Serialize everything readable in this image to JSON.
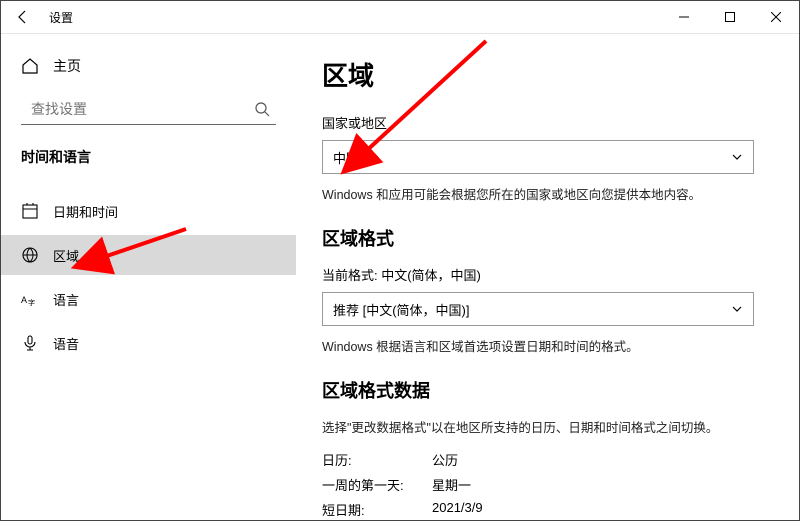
{
  "titlebar": {
    "title": "设置"
  },
  "sidebar": {
    "home": "主页",
    "search_placeholder": "查找设置",
    "category": "时间和语言",
    "items": [
      {
        "label": "日期和时间"
      },
      {
        "label": "区域"
      },
      {
        "label": "语言"
      },
      {
        "label": "语音"
      }
    ]
  },
  "main": {
    "heading": "区域",
    "country_label": "国家或地区",
    "country_value": "中国",
    "country_desc": "Windows 和应用可能会根据您所在的国家或地区向您提供本地内容。",
    "format_heading": "区域格式",
    "current_format_label": "当前格式: 中文(简体，中国)",
    "format_value": "推荐 [中文(简体，中国)]",
    "format_desc": "Windows 根据语言和区域首选项设置日期和时间的格式。",
    "data_heading": "区域格式数据",
    "data_desc": "选择\"更改数据格式\"以在地区所支持的日历、日期和时间格式之间切换。",
    "rows": [
      {
        "k": "日历:",
        "v": "公历"
      },
      {
        "k": "一周的第一天:",
        "v": "星期一"
      },
      {
        "k": "短日期:",
        "v": "2021/3/9"
      }
    ]
  }
}
